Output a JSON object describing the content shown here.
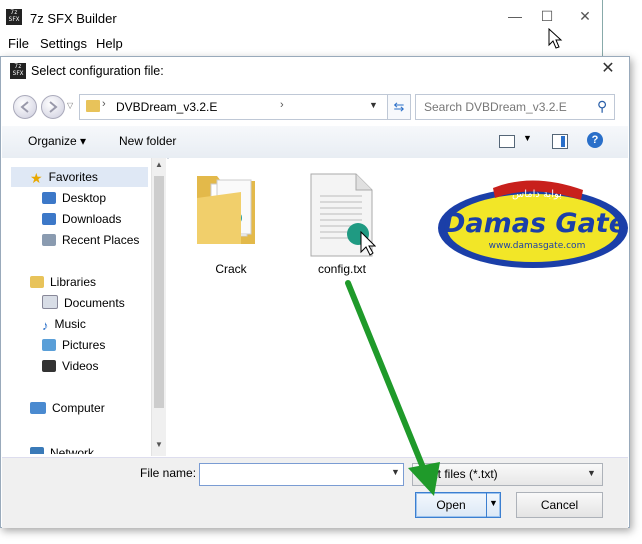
{
  "background_window": {
    "title": "7z SFX Builder",
    "app_icon_text": "7z SFX",
    "menu": [
      "File",
      "Settings",
      "Help"
    ],
    "controls": {
      "minimize": "—",
      "maximize": "☐",
      "close": "✕"
    }
  },
  "dialog": {
    "title": "Select configuration file:",
    "icon_text": "7z SFX",
    "close_glyph": "✕"
  },
  "address_bar": {
    "path": "DVBDream_v3.2.E",
    "separator": "›",
    "after_arrow": "›",
    "dropdown_glyph": "▼",
    "refresh_glyph": "⇆"
  },
  "search": {
    "placeholder": "Search DVBDream_v3.2.E",
    "icon": "⚲"
  },
  "toolbar": {
    "organize_label": "Organize ▾",
    "new_folder_label": "New folder",
    "view_drop": "▼",
    "help_glyph": "?"
  },
  "nav_pane": {
    "favorites_header": "Favorites",
    "favorites": [
      "Desktop",
      "Downloads",
      "Recent Places"
    ],
    "libraries_header": "Libraries",
    "libraries": [
      "Documents",
      "Music",
      "Pictures",
      "Videos"
    ],
    "computer": "Computer",
    "network": "Network",
    "scroll_up": "▲",
    "scroll_down": "▼"
  },
  "files": [
    {
      "name": "Crack",
      "type": "folder"
    },
    {
      "name": "config.txt",
      "type": "text-file"
    }
  ],
  "logo": {
    "arabic": "بوابة داماس",
    "text": "Damas Gate",
    "url": "www.damasgate.com"
  },
  "bottom": {
    "file_name_label": "File name:",
    "file_name_value": "",
    "file_name_drop": "▼",
    "filter": "Text files (*.txt)",
    "filter_drop": "▼",
    "open_label": "Open",
    "open_drop": "▼",
    "cancel_label": "Cancel"
  },
  "colors": {
    "annotation_arrow": "#1f9a2a",
    "selection": "#dfe8f5",
    "logo_blue": "#1b3fa8",
    "logo_yellow": "#f2e627",
    "logo_red": "#c8201c"
  }
}
